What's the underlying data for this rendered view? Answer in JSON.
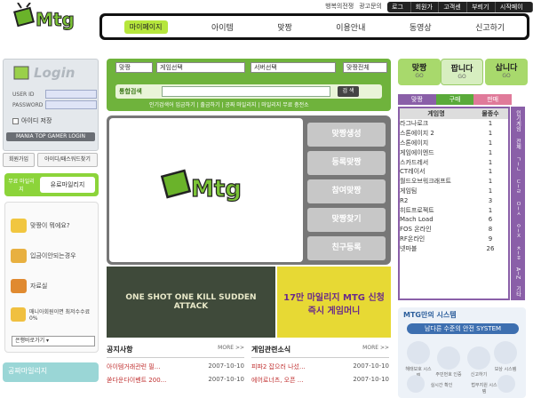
{
  "top_links": [
    "행복의전쟁",
    "광고문의"
  ],
  "top_bar": [
    "로그인",
    "회원가입",
    "고객센터",
    "부릐기가",
    "시작페이지로"
  ],
  "main_nav": [
    "마이페이지",
    "아이템",
    "맞짱",
    "이용안내",
    "동영상",
    "신고하기"
  ],
  "login": {
    "title": "Login",
    "user_id_label": "USER ID",
    "password_label": "PASSWORD",
    "save_id_label": "아이디 저장",
    "gamer_login_label": "MANIA TOP GAMER LOGIN",
    "signup_label": "회원가입",
    "find_label": "아이디/패스워드찾기"
  },
  "mileage": {
    "free_label": "무료 마일리지",
    "paid_label": "유료마일리지"
  },
  "side_promos": [
    "맞짱이 뭐에요?",
    "입금이안되는경우",
    "자료실",
    "매니아회원이면 최저수수료 0%"
  ],
  "bank_select": "은행바로가기",
  "left_bottom": "공짜마일리지",
  "search": {
    "selects": [
      "맞짱",
      "게임선택",
      "서버선택",
      "맞짱전체"
    ],
    "label": "통합검색",
    "button": "검 색",
    "links": "인기검색어 입금하기 | 출금하기 | 공짜 마일리지 | 마일리지 무료 충전소"
  },
  "center_logo": "Mtg",
  "right_buttons": [
    "맞짱생성",
    "등록맞짱",
    "참여맞짱",
    "맞짱찾기",
    "친구등록"
  ],
  "banner1_text": "ONE SHOT ONE KILL SUDDEN ATTACK",
  "banner2_text": "17만 마일리지 MTG 신청즉시 게임머니",
  "notices": {
    "title": "공지사항",
    "more": "MORE >>",
    "rows": [
      {
        "title": "아이템거래관련 필...",
        "date": "2007-10-10"
      },
      {
        "title": "쏟다운다이벤트 200...",
        "date": "2007-10-10"
      }
    ]
  },
  "game_news": {
    "title": "게임관련소식",
    "more": "MORE >>",
    "rows": [
      {
        "title": "피파2 잡으러 나섰...",
        "date": "2007-10-10"
      },
      {
        "title": "에어로너츠, 오픈 ...",
        "date": "2007-10-10"
      }
    ]
  },
  "right_top": [
    {
      "label": "맞짱",
      "sub": "GO",
      "color": "#a8d96c"
    },
    {
      "label": "팝니다",
      "sub": "GO",
      "color": "#d7eec0"
    },
    {
      "label": "삽니다",
      "sub": "GO",
      "color": "#a8d96c"
    }
  ],
  "right_tabs": [
    "맞짱",
    "구매",
    "판매"
  ],
  "game_table": {
    "headers": [
      "게임명",
      "물종수"
    ],
    "rows": [
      [
        "라그나로크",
        "1"
      ],
      [
        "스톤에이지 2",
        "1"
      ],
      [
        "스톤에이지",
        "1"
      ],
      [
        "게임에이엔드",
        "1"
      ],
      [
        "스카드레서",
        "1"
      ],
      [
        "CT레이서",
        "1"
      ],
      [
        "월드오브워크래프트",
        "1"
      ],
      [
        "게임팀",
        "1"
      ],
      [
        "R2",
        "3"
      ],
      [
        "히트프로젝트",
        "1"
      ],
      [
        "Mach Load",
        "6"
      ],
      [
        "FOS 온라인",
        "8"
      ],
      [
        "RF온라인",
        "9"
      ],
      [
        "넷마블",
        "26"
      ]
    ]
  },
  "vtabs": [
    "인기게임",
    "전체",
    "ㄱ~ㄴ",
    "ㄷ~ㄹ",
    "ㅁ~ㅅ",
    "ㅇ~ㅈ",
    "ㅊ~ㅎ",
    "A~Z",
    "기타"
  ],
  "mtg_system": {
    "title": "MTG만의 시스템",
    "subtitle": "남다른 수준의 안전 SYSTEM",
    "icons": [
      "해태보호 시스템",
      "보상 시스템",
      "주민번호 인증",
      "신고하기",
      "실시간 확인",
      "법무지원 시스템"
    ]
  }
}
